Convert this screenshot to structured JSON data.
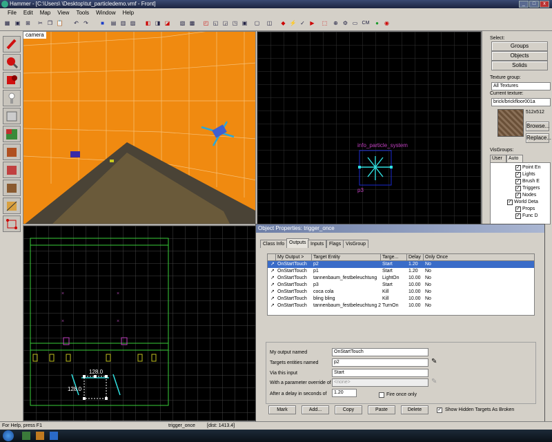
{
  "app": {
    "title": "Hammer - [C:\\Users\\            \\Desktop\\tut_particledemo.vmf - Front]"
  },
  "menu": [
    "File",
    "Edit",
    "Map",
    "View",
    "Tools",
    "Window",
    "Help"
  ],
  "views": {
    "camera_label": "camera",
    "particle_label": "info_particle_system",
    "particle_sub": "p3",
    "dim_width": "128.0",
    "dim_height": "128.0"
  },
  "right": {
    "select_label": "Select:",
    "groups": "Groups",
    "objects": "Objects",
    "solids": "Solids",
    "texture_group_label": "Texture group:",
    "texture_group_value": "All Textures",
    "current_texture_label": "Current texture:",
    "current_texture_value": "brick/brickfloor001a",
    "texture_size": "512x512",
    "browse": "Browse...",
    "replace": "Replace...",
    "visgroups_label": "VisGroups:",
    "tab_user": "User",
    "tab_auto": "Auto",
    "visitems": [
      "Point En",
      "Lights",
      "Brush E",
      "Triggers",
      "Nodes",
      "World Deta",
      "Props",
      "Func D"
    ]
  },
  "dialog": {
    "title": "Object Properties: trigger_once",
    "tabs": [
      "Class Info",
      "Outputs",
      "Inputs",
      "Flags",
      "VisGroup"
    ],
    "headers": [
      "My Output  >",
      "Target Entity",
      "Targe...",
      "Delay",
      "Only Once"
    ],
    "rows": [
      {
        "output": "OnStartTouch",
        "target": "p2",
        "input": "Start",
        "delay": "1.20",
        "once": "No"
      },
      {
        "output": "OnStartTouch",
        "target": "p1",
        "input": "Start",
        "delay": "1.20",
        "once": "No"
      },
      {
        "output": "OnStartTouch",
        "target": "tannenbaum_festbeleuchtung",
        "input": "LightOn",
        "delay": "10.00",
        "once": "No"
      },
      {
        "output": "OnStartTouch",
        "target": "p3",
        "input": "Start",
        "delay": "10.00",
        "once": "No"
      },
      {
        "output": "OnStartTouch",
        "target": "coca cola",
        "input": "Kill",
        "delay": "10.00",
        "once": "No"
      },
      {
        "output": "OnStartTouch",
        "target": "bling bling",
        "input": "Kill",
        "delay": "10.00",
        "once": "No"
      },
      {
        "output": "OnStartTouch",
        "target": "tannenbaum_festbeleuchtung 2",
        "input": "TurnOn",
        "delay": "10.00",
        "once": "No"
      }
    ],
    "my_output_label": "My output named",
    "my_output_value": "OnStartTouch",
    "targets_label": "Targets entities named",
    "targets_value": "p2",
    "via_label": "Via this input",
    "via_value": "Start",
    "param_label": "With a parameter override of",
    "param_value": "<none>",
    "delay_label": "After a delay in seconds of",
    "delay_value": "1.20",
    "fire_once": "Fire once only",
    "buttons": [
      "Mark",
      "Add...",
      "Copy",
      "Paste",
      "Delete"
    ],
    "show_hidden": "Show Hidden Targets As Broken"
  },
  "status": {
    "help": "For Help, press F1",
    "selection": "trigger_once",
    "dist": "[dist: 1413.4]"
  },
  "colors": {
    "camera_wall": "#f08a10",
    "grid_line": "#3a3a3a",
    "accent": "#ff3bff"
  }
}
